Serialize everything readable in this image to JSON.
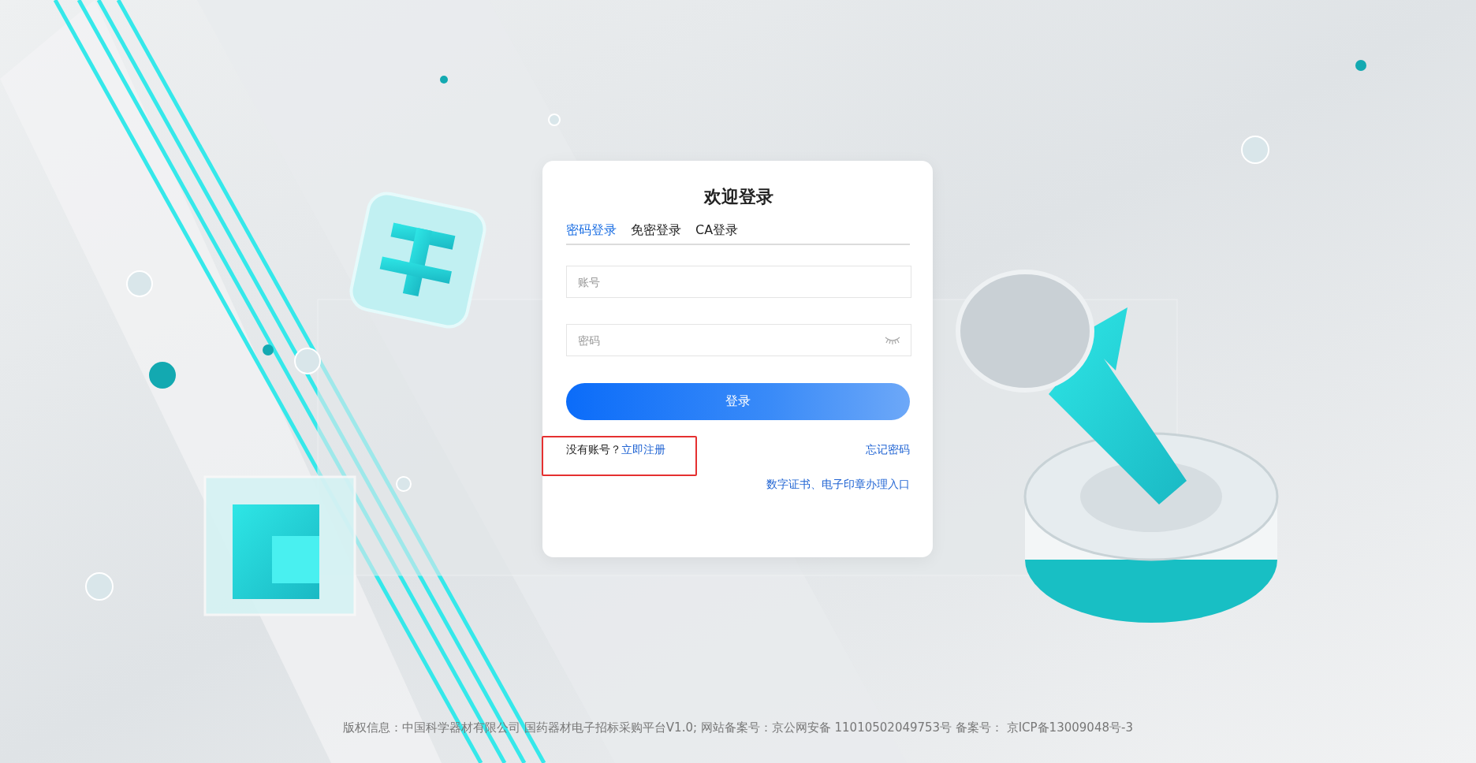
{
  "login": {
    "title": "欢迎登录",
    "tabs": [
      {
        "label": "密码登录",
        "selected": true
      },
      {
        "label": "免密登录",
        "selected": false
      },
      {
        "label": "CA登录",
        "selected": false
      }
    ],
    "account_field": {
      "placeholder": "账号"
    },
    "password_field": {
      "placeholder": "密码"
    },
    "submit_button": "登录",
    "register_prompt": "没有账号？",
    "register_link": "立即注册",
    "register_highlighted": true,
    "forgot_link": "忘记密码",
    "certificate_link": "数字证书、电子印章办理入口"
  },
  "footer": {
    "text": "版权信息：中国科学器材有限公司 国药器材电子招标采购平台V1.0; 网站备案号：京公网安备 11010502049753号 备案号： 京ICP备13009048号-3"
  }
}
